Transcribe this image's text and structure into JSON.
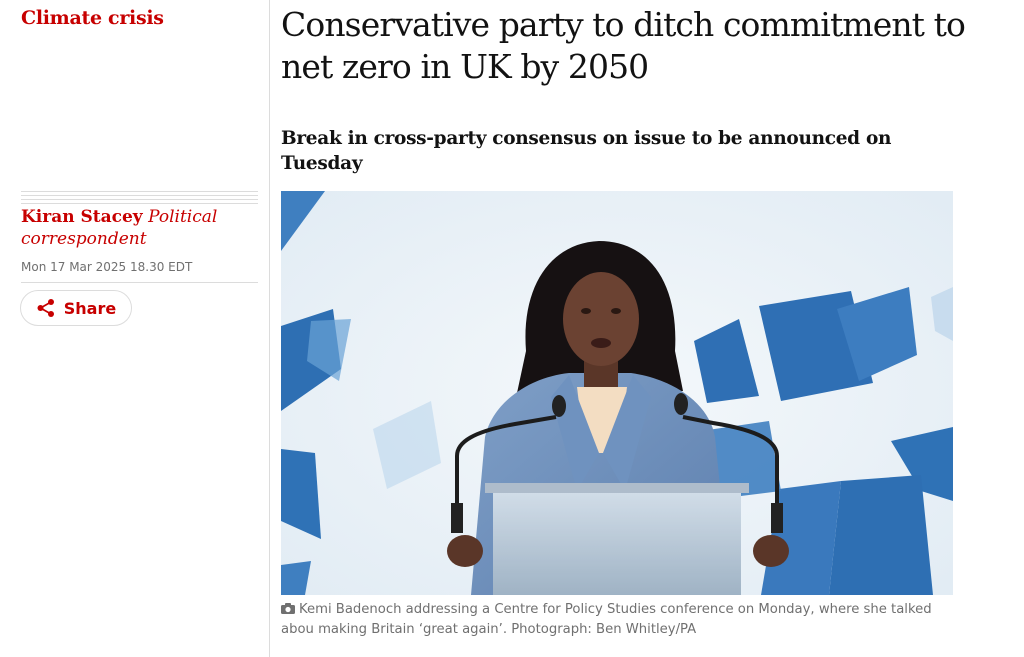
{
  "section": {
    "label": "Climate crisis"
  },
  "byline": {
    "author": "Kiran Stacey",
    "role": "Political correspondent"
  },
  "dateline": "Mon 17 Mar 2025 18.30 EDT",
  "share": {
    "label": "Share",
    "icon": "share-icon"
  },
  "article": {
    "headline": "Conservative party to ditch commitment to net zero in UK by 2050",
    "standfirst": "Break in cross-party consensus on issue to be announced on Tuesday"
  },
  "photo": {
    "caption": "Kemi Badenoch addressing a Centre for Policy Studies conference on Monday, where she talked abou making Britain ‘great again’. Photograph: Ben Whitley/PA",
    "caption_icon": "camera-icon"
  },
  "colors": {
    "accent": "#c70000",
    "text": "#121212",
    "muted": "#707070",
    "rule": "#dcdcdc"
  }
}
